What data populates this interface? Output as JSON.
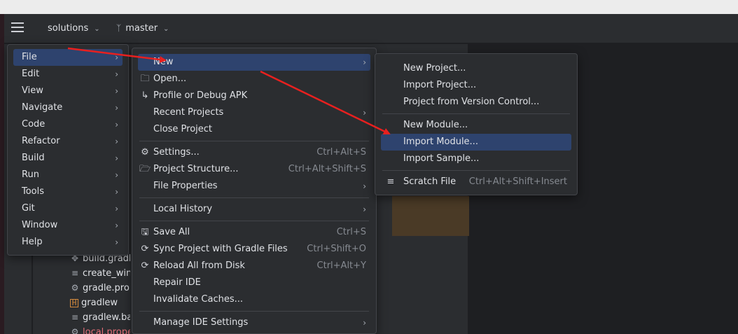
{
  "toolbar": {
    "project_name": "solutions",
    "branch_name": "master"
  },
  "tree": {
    "items": [
      {
        "label": "build.gradle",
        "icon": "gradle-icon"
      },
      {
        "label": "create_win",
        "icon": "text-file-icon"
      },
      {
        "label": "gradle.properties",
        "icon": "settings-file-icon"
      },
      {
        "label": "gradlew",
        "icon": "shell-file-icon"
      },
      {
        "label": "gradlew.bat",
        "icon": "text-file-icon"
      },
      {
        "label": "local.properties",
        "icon": "settings-file-icon"
      }
    ]
  },
  "main_menu": {
    "items": [
      "File",
      "Edit",
      "View",
      "Navigate",
      "Code",
      "Refactor",
      "Build",
      "Run",
      "Tools",
      "Git",
      "Window",
      "Help"
    ]
  },
  "file_menu": {
    "new": "New",
    "open": "Open...",
    "profile_apk": "Profile or Debug APK",
    "recent_projects": "Recent Projects",
    "close_project": "Close Project",
    "settings": "Settings...",
    "settings_sc": "Ctrl+Alt+S",
    "project_structure": "Project Structure...",
    "project_structure_sc": "Ctrl+Alt+Shift+S",
    "file_properties": "File Properties",
    "local_history": "Local History",
    "save_all": "Save All",
    "save_all_sc": "Ctrl+S",
    "sync_gradle": "Sync Project with Gradle Files",
    "sync_gradle_sc": "Ctrl+Shift+O",
    "reload_disk": "Reload All from Disk",
    "reload_disk_sc": "Ctrl+Alt+Y",
    "repair_ide": "Repair IDE",
    "invalidate_caches": "Invalidate Caches...",
    "manage_ide_settings": "Manage IDE Settings"
  },
  "new_menu": {
    "new_project": "New Project...",
    "import_project": "Import Project...",
    "project_from_vcs": "Project from Version Control...",
    "new_module": "New Module...",
    "import_module": "Import Module...",
    "import_sample": "Import Sample...",
    "scratch_file": "Scratch File",
    "scratch_file_sc": "Ctrl+Alt+Shift+Insert"
  },
  "colors": {
    "menu_bg": "#2b2d30",
    "selection": "#2e436e",
    "annotation_arrow": "#e8201f"
  }
}
